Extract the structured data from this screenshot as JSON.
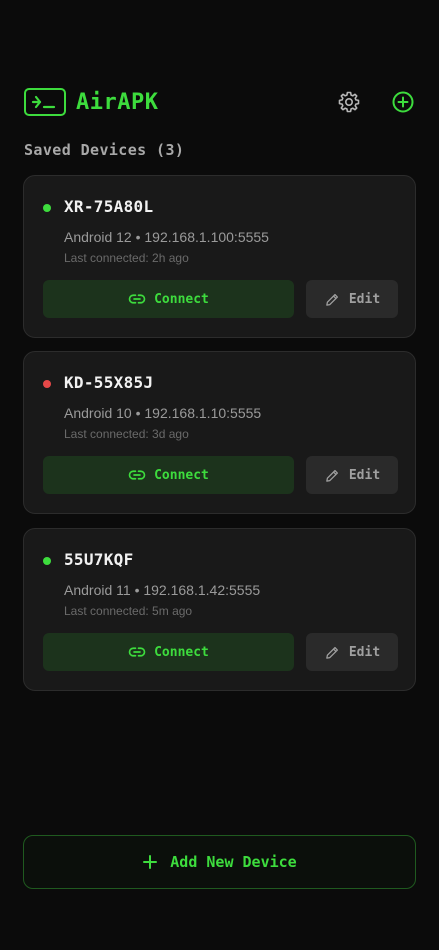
{
  "app": {
    "title": "AirAPK",
    "accent_color": "#3ddc3d"
  },
  "section": {
    "title": "Saved Devices (3)"
  },
  "devices": [
    {
      "name": "XR-75A80L",
      "status": "online",
      "status_color": "#3ddc3d",
      "info": "Android 12 • 192.168.1.100:5555",
      "last_connected": "Last connected: 2h ago",
      "connect_label": "Connect",
      "edit_label": "Edit"
    },
    {
      "name": "KD-55X85J",
      "status": "offline",
      "status_color": "#e54848",
      "info": "Android 10 • 192.168.1.10:5555",
      "last_connected": "Last connected: 3d ago",
      "connect_label": "Connect",
      "edit_label": "Edit"
    },
    {
      "name": "55U7KQF",
      "status": "online",
      "status_color": "#3ddc3d",
      "info": "Android 11 • 192.168.1.42:5555",
      "last_connected": "Last connected: 5m ago",
      "connect_label": "Connect",
      "edit_label": "Edit"
    }
  ],
  "footer": {
    "add_device_label": "Add New Device"
  },
  "icons": {
    "logo": "terminal-download-icon",
    "settings": "gear-icon",
    "add": "plus-circle-icon",
    "connect": "link-icon",
    "edit": "pencil-icon",
    "add_device": "plus-icon"
  }
}
